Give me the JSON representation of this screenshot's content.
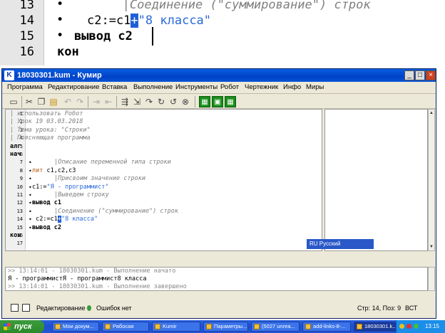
{
  "zoom_lines": [
    {
      "num": "13",
      "bullet": "•",
      "code": "       |Соединение (\"суммирование\") строк",
      "kind": "comment"
    },
    {
      "num": "14",
      "bullet": "•",
      "pre": "c2:=c1",
      "sel": "+",
      "str": "\"8 класса\"",
      "kind": "concat"
    },
    {
      "num": "15",
      "bullet": "•",
      "code": "вывод c2",
      "kind": "kw"
    },
    {
      "num": "16",
      "bullet": "",
      "code": "кон",
      "kind": "kw"
    }
  ],
  "window": {
    "title": "18030301.kum - Кумир",
    "app_icon": "K",
    "controls": [
      "_",
      "□",
      "×"
    ]
  },
  "menu": [
    "Программа",
    "Редактирование",
    "Вставка",
    "Выполнение",
    "Инструменты",
    "Робот",
    "Чертежник",
    "Инфо",
    "Миры"
  ],
  "code_lines": [
    {
      "num": "1",
      "bullet": "",
      "code": "| использовать Робот",
      "kind": "comment"
    },
    {
      "num": "2",
      "bullet": "",
      "code": "| Урок 19 03.03.2018",
      "kind": "comment"
    },
    {
      "num": "3",
      "bullet": "",
      "code": "| Тема урока: \"Строки\"",
      "kind": "comment"
    },
    {
      "num": "4",
      "bullet": "",
      "code": "| Поясняющая программа",
      "kind": "comment"
    },
    {
      "num": "5",
      "bullet": "",
      "code": "алг",
      "kind": "kw"
    },
    {
      "num": "6",
      "bullet": "",
      "code": "нач",
      "kind": "kw"
    },
    {
      "num": "7",
      "bullet": "•",
      "code": "|Описание переменной типа строки",
      "kind": "indcomment"
    },
    {
      "num": "8",
      "bullet": "•",
      "kw": "лит",
      "rest": " c1,c2,c3",
      "kind": "decl"
    },
    {
      "num": "9",
      "bullet": "•",
      "code": "|Присвоим значение строки",
      "kind": "indcomment"
    },
    {
      "num": "10",
      "bullet": "•",
      "pre": "c1:=",
      "str": "\"Я - программист\"",
      "kind": "assign"
    },
    {
      "num": "11",
      "bullet": "•",
      "code": "|Выведем строку",
      "kind": "indcomment"
    },
    {
      "num": "12",
      "bullet": "•",
      "code": "вывод c1",
      "kind": "kw"
    },
    {
      "num": "13",
      "bullet": "•",
      "code": "|Соединение (\"суммирование\") строк",
      "kind": "indcomment"
    },
    {
      "num": "14",
      "bullet": "•",
      "pre": " c2:=c1",
      "sel": "+",
      "str": "\"8 класса\"",
      "kind": "concat"
    },
    {
      "num": "15",
      "bullet": "•",
      "code": "вывод c2",
      "kind": "kw"
    },
    {
      "num": "16",
      "bullet": "",
      "code": "кон",
      "kind": "kw"
    },
    {
      "num": "17",
      "bullet": "",
      "code": "",
      "kind": "kw"
    }
  ],
  "output": {
    "line1": ">> 13:14:01 - 18030301.kum - Выполнение начато",
    "line2": "Я - программистЯ - программист8 класса",
    "line3": ">> 13:14:01 - 18030301.kum - Выполнение завершено"
  },
  "status": {
    "mode": "Редактирование",
    "errors": "Ошибок нет",
    "position": "Стр: 14, Поз: 9",
    "insert_mode": "ВСТ",
    "language": "RU Русский"
  },
  "taskbar": {
    "start": "пуск",
    "tasks": [
      "Мои докум...",
      "Рабосая",
      "Kumir",
      "Параметры...",
      "(5027 unrea...",
      "add-links-8-...",
      "18030301.k...",
      "18030301.k..."
    ],
    "clock": "13:15"
  },
  "colors": {
    "selection": "#1f5fd8",
    "string": "#2a6ad8",
    "comment": "#808080",
    "titlebar": "#0042c8"
  }
}
